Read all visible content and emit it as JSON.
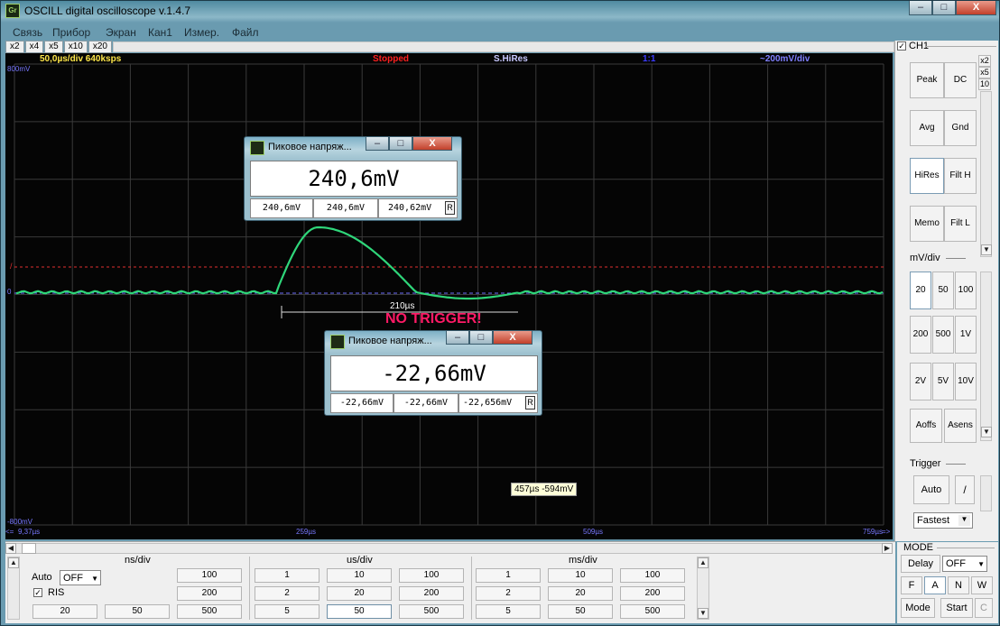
{
  "window": {
    "title": "OSCILL digital oscilloscope  v.1.4.7",
    "icon_text": "Gr",
    "minimize": "–",
    "maximize": "□",
    "close": "X"
  },
  "menu": [
    "Связь",
    "Прибор",
    "Экран",
    "Кан1",
    "Измер.",
    "Файл"
  ],
  "zoom_buttons": [
    "x2",
    "x4",
    "x5",
    "x10",
    "x20"
  ],
  "scope_header": {
    "timebase": "50,0µs/div  640ksps",
    "state": "Stopped",
    "mode": "S.HiRes",
    "ratio": "1:1",
    "vdiv": "~200mV/div"
  },
  "axis": {
    "top_label": "800mV",
    "bottom_label": "-800mV",
    "zero_label": "0",
    "trig_label": "/",
    "x_ticks": [
      "9,37µs",
      "259µs",
      "509µs",
      "759µs"
    ]
  },
  "annotations": {
    "span": "210µs",
    "no_trigger": "NO TRIGGER!",
    "cursor_readout": "457µs  -594mV"
  },
  "dialog_max": {
    "title": "Пиковое напряж...",
    "value": "240,6mV",
    "cells": [
      "240,6mV",
      "240,6mV",
      "240,62mV"
    ],
    "reset": "R"
  },
  "dialog_min": {
    "title": "Пиковое напряж...",
    "value": "-22,66mV",
    "cells": [
      "-22,66mV",
      "-22,66mV",
      "-22,656mV"
    ],
    "reset": "R"
  },
  "channel_panel": {
    "checkbox_label": "CH1",
    "zoom": [
      "x2",
      "x5",
      "10"
    ],
    "buttons": [
      [
        "Peak",
        "DC"
      ],
      [
        "Avg",
        "Gnd"
      ],
      [
        "HiRes",
        "Filt H"
      ],
      [
        "Memo",
        "Filt L"
      ]
    ],
    "mvdiv_title": "mV/div",
    "mvdiv_buttons": [
      [
        "20",
        "50",
        "100"
      ],
      [
        "200",
        "500",
        "1V"
      ],
      [
        "2V",
        "5V",
        "10V"
      ]
    ],
    "aoffs": "Aoffs",
    "asens": "Asens",
    "trigger_title": "Trigger",
    "trigger_auto": "Auto",
    "trigger_edge": "/",
    "trigger_speed": "Fastest"
  },
  "bottom": {
    "ns_title": "ns/div",
    "us_title": "us/div",
    "ms_title": "ms/div",
    "auto_label": "Auto",
    "auto_value": "OFF",
    "ris_label": "RIS",
    "ns_buttons": [
      "100",
      "200",
      "500"
    ],
    "ns_row3": [
      "20",
      "50"
    ],
    "us_buttons": [
      [
        "1",
        "10",
        "100"
      ],
      [
        "2",
        "20",
        "200"
      ],
      [
        "5",
        "50",
        "500"
      ]
    ],
    "ms_buttons": [
      [
        "1",
        "10",
        "100"
      ],
      [
        "2",
        "20",
        "200"
      ],
      [
        "5",
        "50",
        "500"
      ]
    ]
  },
  "mode_panel": {
    "title": "MODE",
    "delay": "Delay",
    "delay_value": "OFF",
    "modes": [
      "F",
      "A",
      "N",
      "W"
    ],
    "mode_btn": "Mode",
    "start_btn": "Start",
    "c_btn": "C"
  },
  "colors": {
    "trace": "#2fd67a",
    "state": "#ff2020",
    "timebase": "#ffe74a",
    "mode": "#c8c8ff",
    "ratio": "#3c3cff",
    "vdiv": "#8080ff",
    "no_trigger": "#ff1a66"
  }
}
